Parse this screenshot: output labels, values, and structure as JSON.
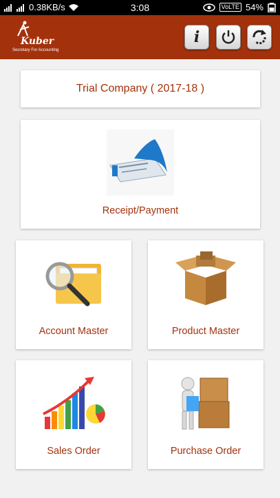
{
  "status_bar": {
    "speed": "0.38KB/s",
    "time": "3:08",
    "network": "VoLTE",
    "battery": "54%"
  },
  "app_bar": {
    "logo_text": "Kuber",
    "logo_tagline": "Secretary For Accounting",
    "icons": [
      "info-icon",
      "power-icon",
      "sync-icon"
    ],
    "color": "#a3320c"
  },
  "company": {
    "name": "Trial Company ( 2017-18 )"
  },
  "tiles": {
    "receipt_payment": {
      "label": "Receipt/Payment",
      "icon": "receipt-icon"
    },
    "account_master": {
      "label": "Account Master",
      "icon": "folder-search-icon"
    },
    "product_master": {
      "label": "Product Master",
      "icon": "box-icon"
    },
    "sales_order": {
      "label": "Sales Order",
      "icon": "bar-chart-icon"
    },
    "purchase_order": {
      "label": "Purchase Order",
      "icon": "boxes-person-icon"
    }
  }
}
